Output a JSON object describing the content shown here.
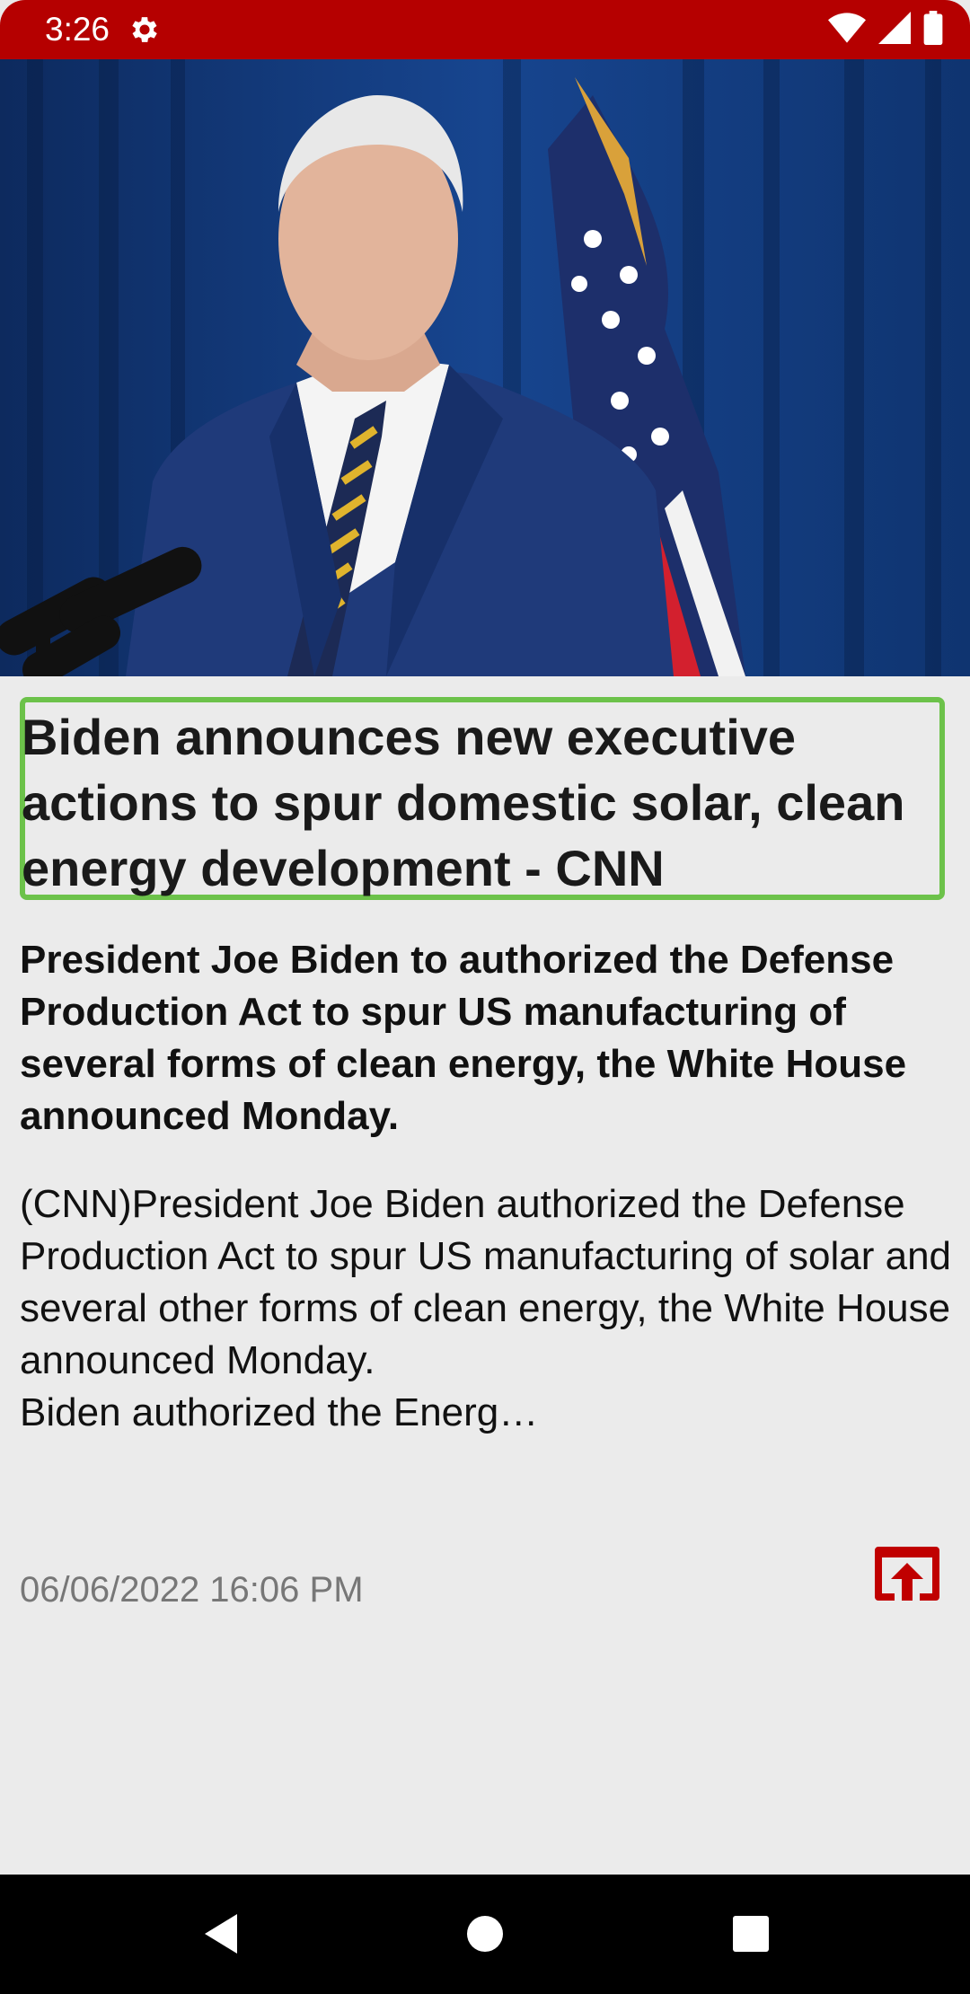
{
  "status_bar": {
    "time": "3:26",
    "background_color": "#b50000",
    "icons": [
      "settings-icon",
      "wifi-icon",
      "signal-icon",
      "battery-icon"
    ]
  },
  "article": {
    "hero_image": "photo of Joe Biden at podium with US flag",
    "headline": "Biden announces new executive actions to spur domestic solar, clean energy development - CNN",
    "summary": "President Joe Biden to authorized the Defense Production Act to spur US manufacturing of several forms of clean energy, the White House announced Monday.",
    "body": "(CNN)President Joe Biden authorized the Defense Production Act to spur US manufacturing of solar and several other forms of clean energy, the White House announced Monday.\nBiden authorized the Energ…",
    "timestamp": "06/06/2022 16:06 PM",
    "open_icon": "open-in-browser-icon",
    "accent_color": "#c00000",
    "highlight_color": "#6cc24a"
  },
  "nav_bar": {
    "buttons": [
      "back-icon",
      "home-icon",
      "recents-icon"
    ]
  }
}
